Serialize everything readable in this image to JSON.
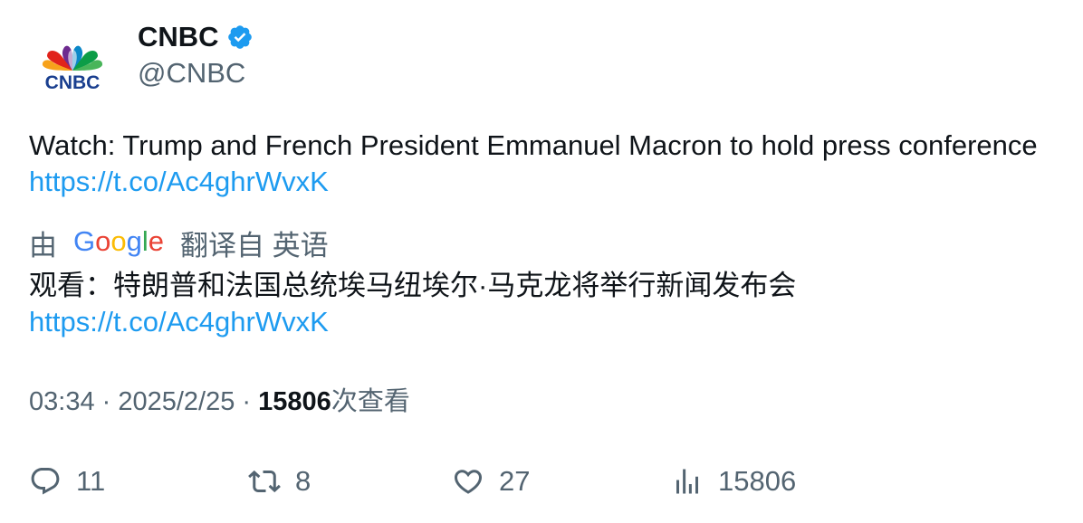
{
  "author": {
    "name": "CNBC",
    "handle": "@CNBC",
    "logo_text": "CNBC",
    "verified_icon": "verified-badge-icon"
  },
  "tweet": {
    "text": "Watch: Trump and French President Emmanuel Macron to hold press conference ",
    "link": "https://t.co/Ac4ghrWvxK"
  },
  "translation": {
    "prefix": "由",
    "provider": "Google",
    "suffix": "翻译自 英语",
    "text": "观看：特朗普和法国总统埃马纽埃尔·马克龙将举行新闻发布会",
    "link": "https://t.co/Ac4ghrWvxK"
  },
  "meta": {
    "time": "03:34",
    "separator": " · ",
    "date": "2025/2/25",
    "views_count": "15806",
    "views_label": "次查看"
  },
  "actions": {
    "replies": "11",
    "retweets": "8",
    "likes": "27",
    "views": "15806"
  },
  "colors": {
    "link": "#1d9bf0",
    "secondary_text": "#536471",
    "primary_text": "#0f1419",
    "verified": "#1d9bf0"
  }
}
